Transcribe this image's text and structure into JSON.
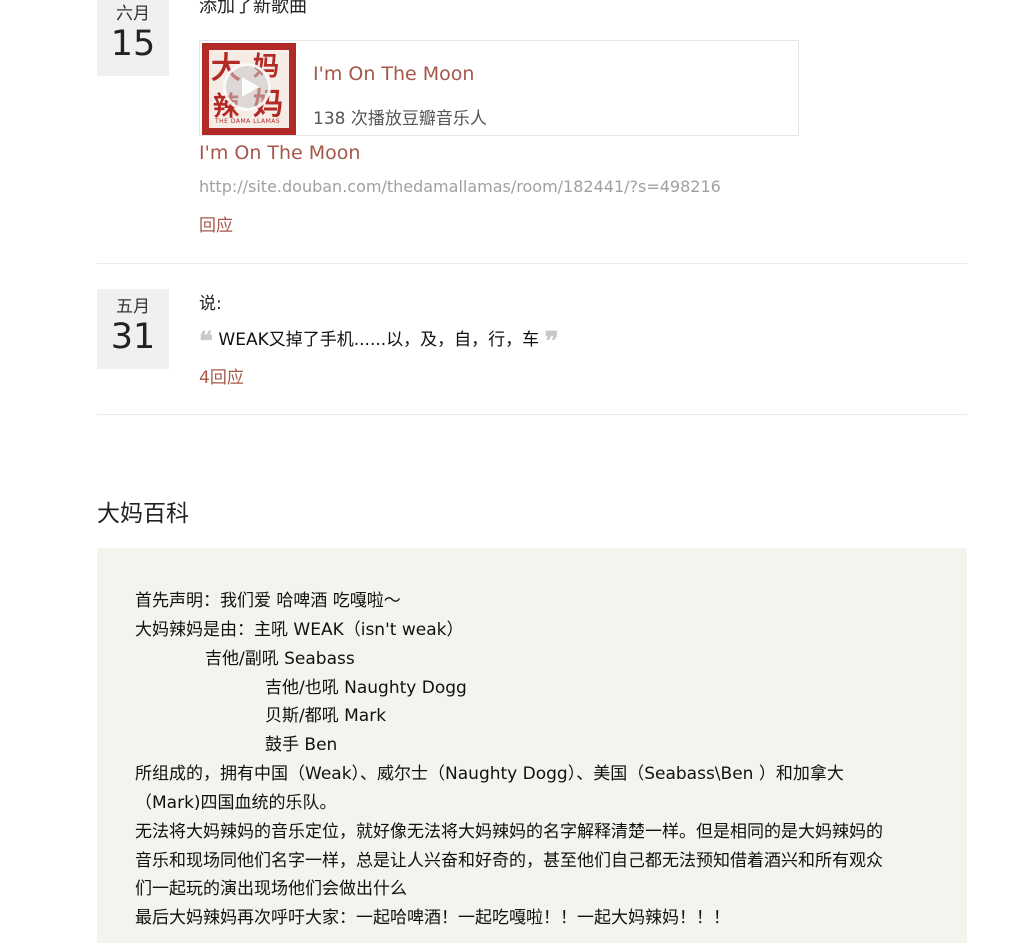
{
  "feed": [
    {
      "month": "六月",
      "day": "15",
      "action": "添加了新歌曲",
      "song": {
        "title": "I'm On The Moon",
        "plays": "138 次播放豆瓣音乐人",
        "cover_chars": [
          "大",
          "妈",
          "辣",
          "妈"
        ],
        "cover_caption": "THE DAMA LLAMAS"
      },
      "link_title": "I'm On The Moon",
      "url": "http://site.douban.com/thedamallamas/room/182441/?s=498216",
      "reply_label": "回应"
    },
    {
      "month": "五月",
      "day": "31",
      "action": "说:",
      "quote_open": "❝",
      "quote_text": "WEAK又掉了手机......以，及，自，行，车",
      "quote_close": "❞",
      "reply_label": "4回应"
    }
  ],
  "section_title": "大妈百科",
  "bio_lines": [
    "首先声明：我们爱 哈啤酒 吃嘎啦～",
    "大妈辣妈是由：主吼 WEAK（isn't weak）",
    "吉他/副吼 Seabass",
    "吉他/也吼 Naughty Dogg",
    "贝斯/都吼 Mark",
    "鼓手 Ben",
    "所组成的，拥有中国（Weak）、威尔士（Naughty Dogg）、美国（Seabass\\Ben ）和加拿大",
    "（Mark)四国血统的乐队。",
    "无法将大妈辣妈的音乐定位，就好像无法将大妈辣妈的名字解释清楚一样。但是相同的是大妈辣妈的",
    "音乐和现场同他们名字一样，总是让人兴奋和好奇的，甚至他们自己都无法预知借着酒兴和所有观众",
    "们一起玩的演出现场他们会做出什么",
    "最后大妈辣妈再次呼吁大家：一起哈啤酒！一起吃嘎啦！！一起大妈辣妈！！！"
  ],
  "colors": {
    "link": "#a6574a",
    "date_bg": "#f0f0f0",
    "bio_bg": "#f4f3ee",
    "cover_red": "#b22a25"
  }
}
